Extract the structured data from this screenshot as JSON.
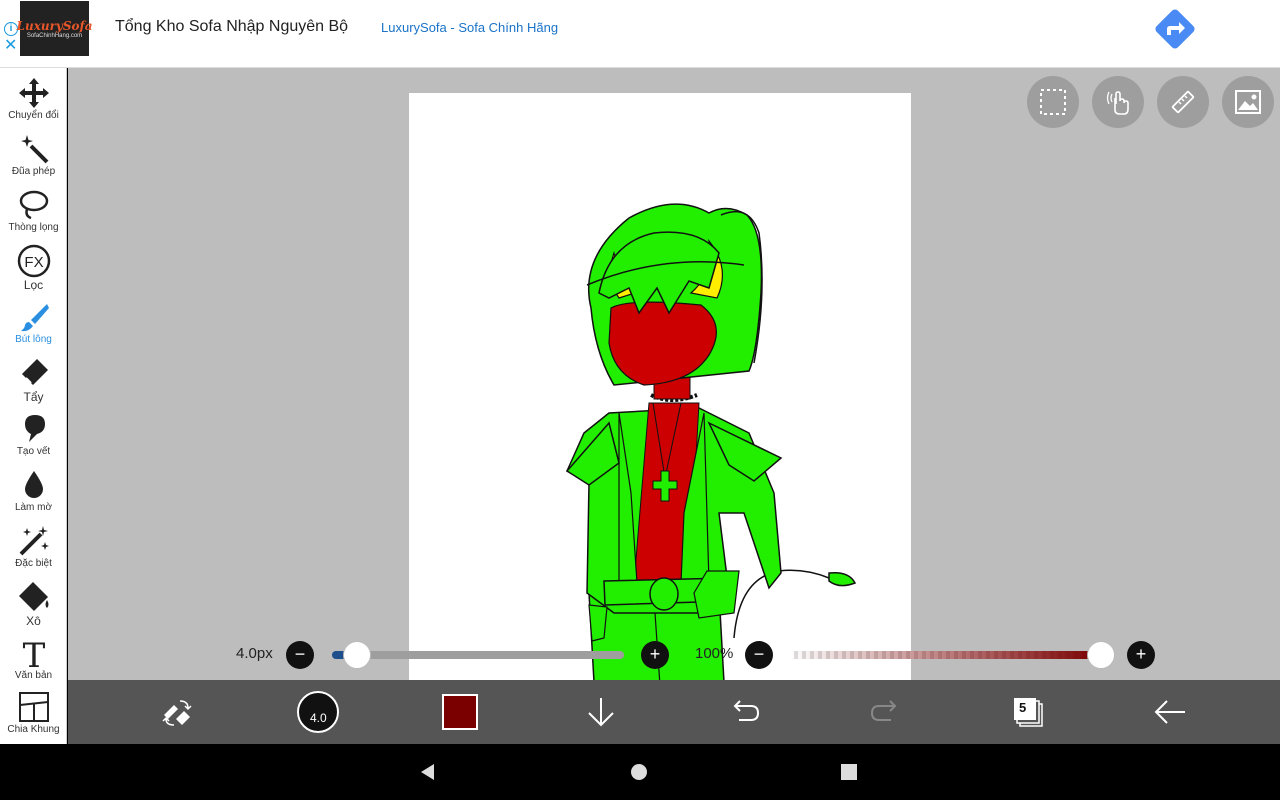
{
  "ad": {
    "info_icon": "info-icon",
    "close_icon": "close-icon",
    "logo_text": "LuxurySofa",
    "logo_sub": "SofaChinhHang.com",
    "title": "Tổng Kho Sofa Nhập Nguyên Bộ",
    "link": "LuxurySofa - Sofa Chính Hãng",
    "action_icon": "directions-arrow-icon",
    "action_color": "#4a8af4"
  },
  "tools": [
    {
      "label": "Chuyển đổi",
      "icon": "move-icon"
    },
    {
      "label": "Đũa phép",
      "icon": "magic-wand-icon"
    },
    {
      "label": "Thòng lọng",
      "icon": "lasso-icon"
    },
    {
      "label": "Lọc",
      "icon": "fx-filter-icon"
    },
    {
      "label": "Bút lông",
      "icon": "brush-icon",
      "active": true
    },
    {
      "label": "Tẩy",
      "icon": "eraser-icon"
    },
    {
      "label": "Tạo vết",
      "icon": "smudge-icon"
    },
    {
      "label": "Làm mờ",
      "icon": "blur-drop-icon"
    },
    {
      "label": "Đặc biệt",
      "icon": "special-icon"
    },
    {
      "label": "Xô",
      "icon": "bucket-icon"
    },
    {
      "label": "Văn bản",
      "icon": "text-icon"
    },
    {
      "label": "Chia Khung",
      "icon": "frame-divide-icon"
    }
  ],
  "top_buttons": [
    "selection-icon",
    "hand-touch-icon",
    "ruler-icon",
    "image-icon"
  ],
  "brush_size": {
    "label": "4.0px",
    "value": 4.0,
    "minus": "−",
    "plus": "+"
  },
  "opacity": {
    "label": "100%",
    "value": 100,
    "minus": "−",
    "plus": "+"
  },
  "bottom": {
    "brush_size_badge": "4.0",
    "current_color": "#7a0000",
    "layer_count": "5"
  },
  "colors": {
    "accent": "#2a8fe0",
    "workspace": "#bdbdbd"
  }
}
